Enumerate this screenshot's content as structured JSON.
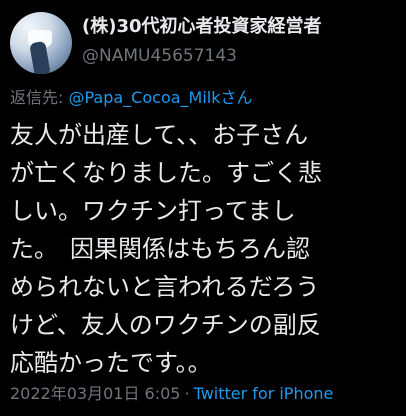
{
  "author": {
    "display_name": "(株)30代初心者投資家経営者",
    "handle": "@NAMU45657143"
  },
  "reply": {
    "prefix": "返信先: ",
    "to": "@Papa_Cocoa_Milkさん"
  },
  "tweet": {
    "lines": [
      "友人が出産して、、お子さん",
      "が亡くなりました。すごく悲",
      "しい。ワクチン打ってまし",
      "た。　因果関係はもちろん認",
      "められないと言われるだろう",
      "けど、友人のワクチンの副反",
      "応酷かったです。。"
    ]
  },
  "meta": {
    "timestamp": "2022年03月01日 6:05",
    "separator": "·",
    "source": "Twitter for iPhone"
  },
  "colors": {
    "background": "#000000",
    "text": "#e7e9ea",
    "secondary": "#71767b",
    "link": "#1d9bf0"
  },
  "icons": {
    "avatar": "profile-avatar"
  }
}
